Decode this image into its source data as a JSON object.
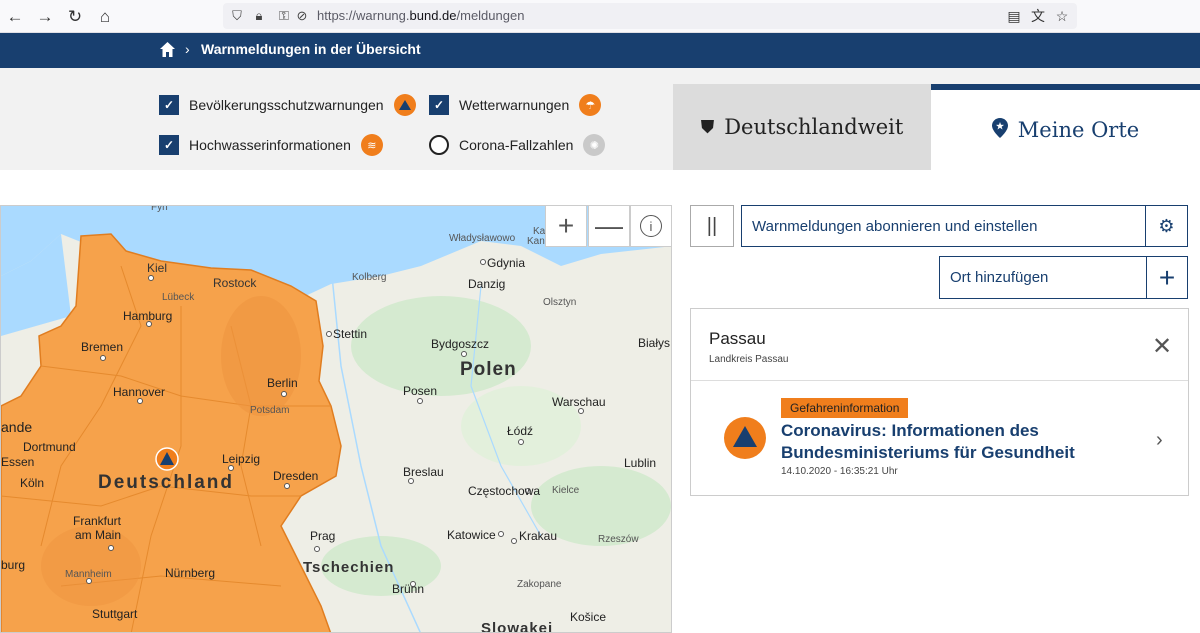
{
  "browser": {
    "url_prefix": "https://warnung.",
    "url_domain": "bund.de",
    "url_path": "/meldungen"
  },
  "header": {
    "breadcrumb": "Warnmeldungen in der Übersicht"
  },
  "filters": [
    {
      "label": "Bevölkerungsschutzwarnungen",
      "checked": true,
      "icon": "civil-protection-icon"
    },
    {
      "label": "Wetterwarnungen",
      "checked": true,
      "icon": "weather-icon"
    },
    {
      "label": "Hochwasserinformationen",
      "checked": true,
      "icon": "flood-icon"
    },
    {
      "label": "Corona-Fallzahlen",
      "checked": false,
      "icon": "corona-icon"
    }
  ],
  "tabs": {
    "nationwide": "Deutschlandweit",
    "my_places": "Meine Orte"
  },
  "map": {
    "labels": {
      "fyn": "Fyn",
      "wladyslawowo": "Władysławowo",
      "ka": "Ka",
      "kan": "Kan",
      "kiel": "Kiel",
      "rostock": "Rostock",
      "kolberg": "Kolberg",
      "gdynia": "Gdynia",
      "danzig": "Danzig",
      "luebeck": "Lübeck",
      "olsztyn": "Olsztyn",
      "hamburg": "Hamburg",
      "stettin": "Stettin",
      "bremen": "Bremen",
      "bydgoszcz": "Bydgoszcz",
      "bialys": "Białys",
      "polen": "Polen",
      "hannover": "Hannover",
      "berlin": "Berlin",
      "potsdam": "Potsdam",
      "posen": "Posen",
      "warschau": "Warschau",
      "ande": "ande",
      "dortmund": "Dortmund",
      "essen": "Essen",
      "leipzig": "Leipzig",
      "lodz": "Łódź",
      "lublin": "Lublin",
      "dresden": "Dresden",
      "breslau": "Breslau",
      "koeln": "Köln",
      "deutschland": "Deutschland",
      "czestochowa": "Częstochowa",
      "kielce": "Kielce",
      "frankfurt": "Frankfurt",
      "am_main": "am Main",
      "prag": "Prag",
      "katowice": "Katowice",
      "krakau": "Krakau",
      "rzeszow": "Rzeszów",
      "burg": "burg",
      "mannheim": "Mannheim",
      "nuernberg": "Nürnberg",
      "tschechien": "Tschechien",
      "zakopane": "Zakopane",
      "bruenn": "Brünn",
      "stuttgart": "Stuttgart",
      "kosice": "Košice",
      "slowakei": "Slowakei"
    },
    "zoom_in": "+",
    "zoom_out": "—",
    "info": "i"
  },
  "panel": {
    "pause": "||",
    "subscribe": "Warnmeldungen abonnieren und einstellen",
    "add_place": "Ort hinzufügen",
    "add_symbol": "+"
  },
  "location_card": {
    "place": "Passau",
    "district": "Landkreis Passau",
    "warning": {
      "tag": "Gefahreninformation",
      "title": "Coronavirus: Informationen des Bundesministeriums für Gesundheit",
      "date": "14.10.2020 - 16:35:21 Uhr"
    }
  },
  "colors": {
    "brand_blue": "#183f6f",
    "warning_orange": "#f07e1c"
  }
}
